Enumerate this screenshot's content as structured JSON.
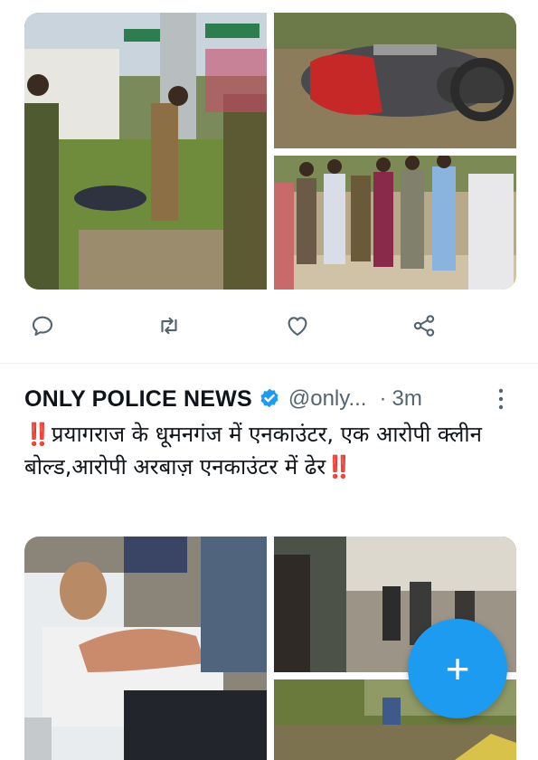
{
  "previous_tweet": {
    "media_alts": [
      "photo-crime-scene-highway",
      "photo-crashed-motorcycle",
      "photo-police-officers-group"
    ],
    "actions": {
      "reply_icon": "reply-icon",
      "retweet_icon": "retweet-icon",
      "like_icon": "heart-icon",
      "share_icon": "share-icon"
    }
  },
  "tweet": {
    "author": "ONLY POLICE NEWS",
    "handle": "@only...",
    "separator": "·",
    "time": "3m",
    "text_lead_emoji": "‼️",
    "text_line": "प्रयागराज के धूमनगंज में एनकाउंटर, एक आरोपी क्लीन बोल्ड,आरोपी अरबाज़ एनकाउंटर में ढेर",
    "text_trail_emoji": "‼️",
    "media_alts": [
      "photo-injured-man-on-stretcher",
      "photo-hospital-corridor",
      "photo-bushes-ground"
    ]
  },
  "fab": {
    "label": "+"
  },
  "colors": {
    "accent": "#1d9bf0",
    "secondary_text": "#536471",
    "alert": "#e0202a"
  }
}
